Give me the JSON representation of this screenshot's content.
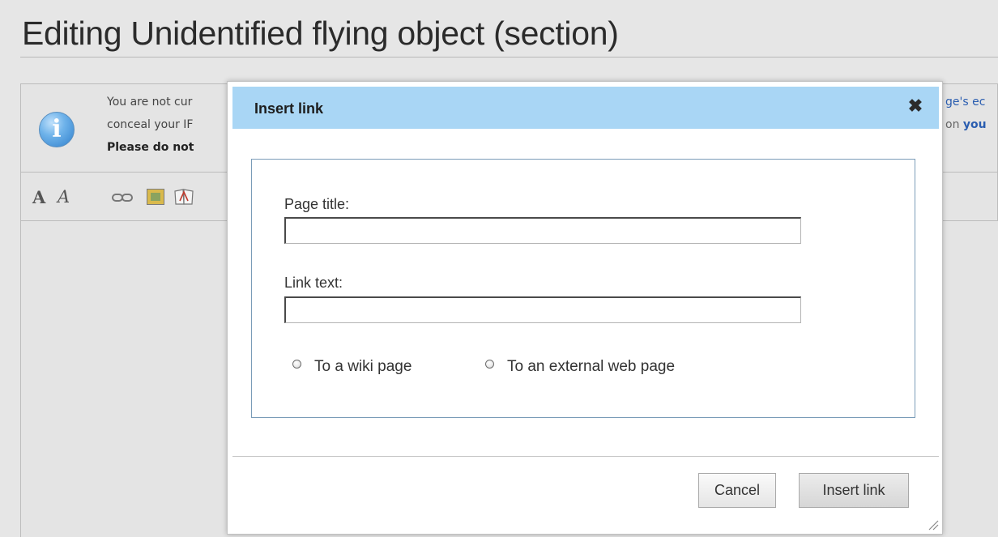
{
  "page": {
    "title": "Editing Unidentified flying object (section)"
  },
  "notice": {
    "line1": "You are not cur",
    "line2": "conceal your IF",
    "line3": "Please do not",
    "right1": "ge's ec",
    "right2_prefix": "on ",
    "right2_link": "you"
  },
  "toolbar": {
    "bold_label": "A",
    "italic_label": "A",
    "link_icon": "link-icon",
    "image_icon": "image-icon",
    "reference_icon": "reference-icon"
  },
  "dialog": {
    "title": "Insert link",
    "close_glyph": "✖",
    "page_title_label": "Page title:",
    "page_title_value": "",
    "link_text_label": "Link text:",
    "link_text_value": "",
    "radio_wiki_label": "To a wiki page",
    "radio_external_label": "To an external web page",
    "cancel_label": "Cancel",
    "insert_label": "Insert link"
  },
  "colors": {
    "header_bg": "#a9d6f5",
    "panel_border": "#7a9cb8",
    "page_bg": "#e6e6e6"
  }
}
